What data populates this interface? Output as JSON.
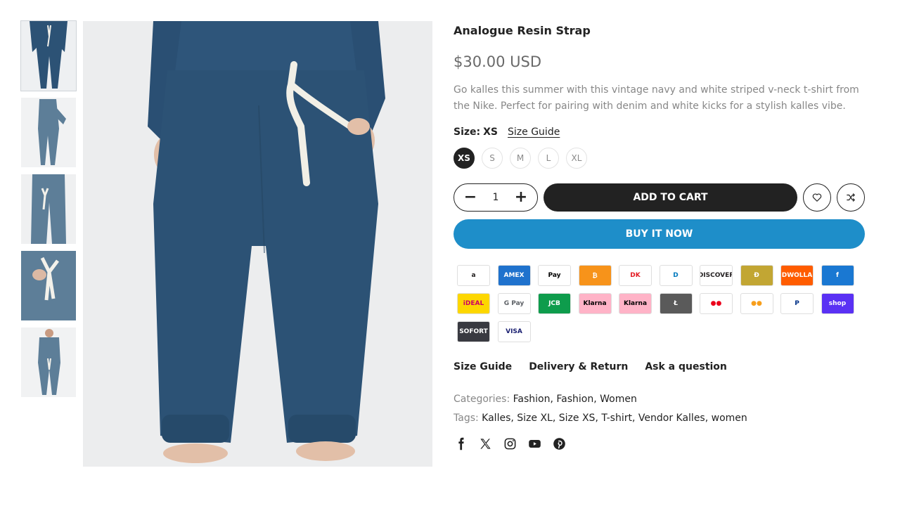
{
  "product": {
    "title": "Analogue Resin Strap",
    "price": "$30.00 USD",
    "description": "Go kalles this summer with this vintage navy and white striped v-neck t-shirt from the Nike. Perfect for pairing with denim and white kicks for a stylish kalles vibe.",
    "image_subject": "navy-jogger-pants"
  },
  "thumbnails": [
    {
      "name": "thumbnail-1",
      "view": "full-outfit-front"
    },
    {
      "name": "thumbnail-2",
      "view": "full-outfit-side"
    },
    {
      "name": "thumbnail-3",
      "view": "pants-closeup"
    },
    {
      "name": "thumbnail-4",
      "view": "drawstring-closeup"
    },
    {
      "name": "thumbnail-5",
      "view": "full-outfit-walking"
    }
  ],
  "size": {
    "label": "Size:",
    "selected": "XS",
    "guide_link": "Size Guide",
    "options": [
      "XS",
      "S",
      "M",
      "L",
      "XL"
    ]
  },
  "quantity": {
    "minus": "−",
    "value": "1",
    "plus": "+"
  },
  "buttons": {
    "add_to_cart": "ADD TO CART",
    "buy_now": "BUY IT NOW",
    "wishlist_icon": "heart-icon",
    "compare_icon": "shuffle-icon"
  },
  "payments": [
    {
      "name": "amazon",
      "label": "a",
      "color": "#221f1f",
      "bg": "#ffffff"
    },
    {
      "name": "american-express",
      "label": "AMEX",
      "color": "#ffffff",
      "bg": "#1f72cd"
    },
    {
      "name": "apple-pay",
      "label": " Pay",
      "color": "#000000",
      "bg": "#ffffff"
    },
    {
      "name": "bitcoin",
      "label": "₿",
      "color": "#ffffff",
      "bg": "#f7931a"
    },
    {
      "name": "dankort",
      "label": "DK",
      "color": "#e31b23",
      "bg": "#ffffff"
    },
    {
      "name": "diners-club",
      "label": "D",
      "color": "#0079be",
      "bg": "#ffffff"
    },
    {
      "name": "discover",
      "label": "DISCOVER",
      "color": "#231f20",
      "bg": "#ffffff"
    },
    {
      "name": "dogecoin",
      "label": "Ð",
      "color": "#ffffff",
      "bg": "#c2a633"
    },
    {
      "name": "dwolla",
      "label": "DWOLLA",
      "color": "#ffffff",
      "bg": "#ff5c00"
    },
    {
      "name": "forbrugsforeningen",
      "label": "f",
      "color": "#ffffff",
      "bg": "#1a78d2"
    },
    {
      "name": "ideal",
      "label": "iDEAL",
      "color": "#cc0066",
      "bg": "#fdd700"
    },
    {
      "name": "google-pay",
      "label": "G Pay",
      "color": "#5f6368",
      "bg": "#ffffff"
    },
    {
      "name": "jcb",
      "label": "JCB",
      "color": "#ffffff",
      "bg": "#0e9c4c"
    },
    {
      "name": "klarna",
      "label": "Klarna",
      "color": "#000000",
      "bg": "#ffb3c7"
    },
    {
      "name": "klarna-pay-later",
      "label": "Klarna",
      "color": "#000000",
      "bg": "#ffb3c7"
    },
    {
      "name": "litecoin",
      "label": "Ł",
      "color": "#ffffff",
      "bg": "#5a5a5a"
    },
    {
      "name": "maestro",
      "label": "●●",
      "color": "#eb001b",
      "bg": "#ffffff"
    },
    {
      "name": "mastercard",
      "label": "●●",
      "color": "#f79e1b",
      "bg": "#ffffff"
    },
    {
      "name": "paypal",
      "label": "P",
      "color": "#003087",
      "bg": "#ffffff"
    },
    {
      "name": "shop-pay",
      "label": "shop",
      "color": "#ffffff",
      "bg": "#5a31f4"
    },
    {
      "name": "sofort",
      "label": "SOFORT",
      "color": "#ffffff",
      "bg": "#393a41"
    },
    {
      "name": "visa",
      "label": "VISA",
      "color": "#1a1f71",
      "bg": "#ffffff"
    }
  ],
  "tabs": [
    "Size Guide",
    "Delivery & Return",
    "Ask a question"
  ],
  "categories": {
    "label": "Categories:",
    "items": [
      "Fashion",
      "Fashion",
      "Women"
    ]
  },
  "tags": {
    "label": "Tags:",
    "items": [
      "Kalles",
      "Size XL",
      "Size XS",
      "T-shirt",
      "Vendor Kalles",
      "women"
    ]
  },
  "social": [
    "facebook-icon",
    "x-twitter-icon",
    "instagram-icon",
    "youtube-icon",
    "pinterest-icon"
  ],
  "colors": {
    "navy": "#2c5275",
    "dark": "#222222",
    "buy_now": "#1e8ec9",
    "muted": "#878787"
  }
}
